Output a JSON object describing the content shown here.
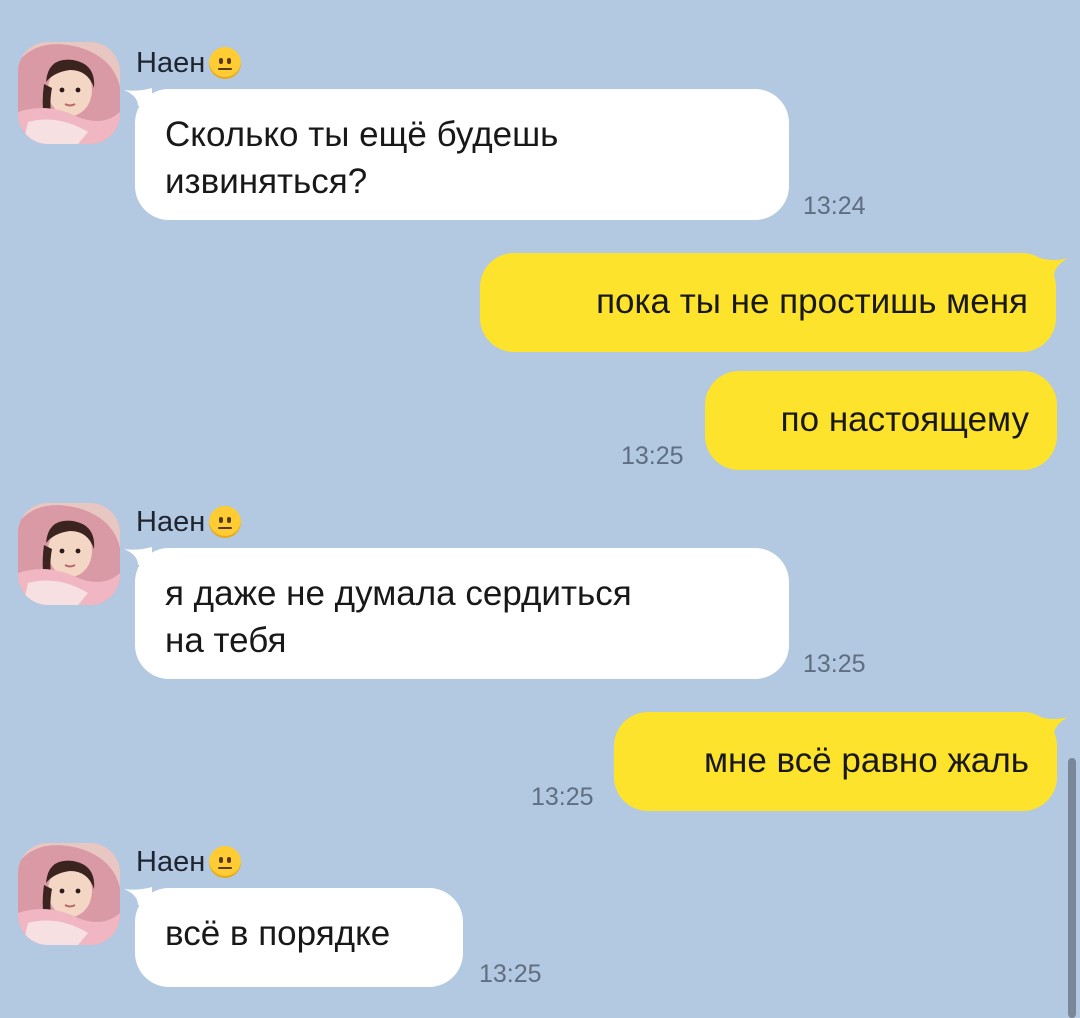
{
  "contact": {
    "name": "Наен",
    "status_emoji_icon": "neutral-face-emoji"
  },
  "messages": [
    {
      "direction": "incoming",
      "sender": "Наен",
      "text_lines": [
        "Сколько ты ещё будешь",
        "извиняться?"
      ],
      "time": "13:24"
    },
    {
      "direction": "outgoing",
      "text": "пока ты не простишь меня",
      "time": ""
    },
    {
      "direction": "outgoing",
      "text": "по настоящему",
      "time": "13:25"
    },
    {
      "direction": "incoming",
      "sender": "Наен",
      "text_lines": [
        "я даже не думала сердиться",
        "на тебя"
      ],
      "time": "13:25"
    },
    {
      "direction": "outgoing",
      "text": "мне всё равно жаль",
      "time": "13:25"
    },
    {
      "direction": "incoming",
      "sender": "Наен",
      "text_lines": [
        "всё в порядке"
      ],
      "time": "13:25"
    }
  ],
  "colors": {
    "background": "#b3c8e1",
    "incoming_bubble": "#ffffff",
    "outgoing_bubble": "#fde32c",
    "timestamp": "#5f6e80"
  }
}
